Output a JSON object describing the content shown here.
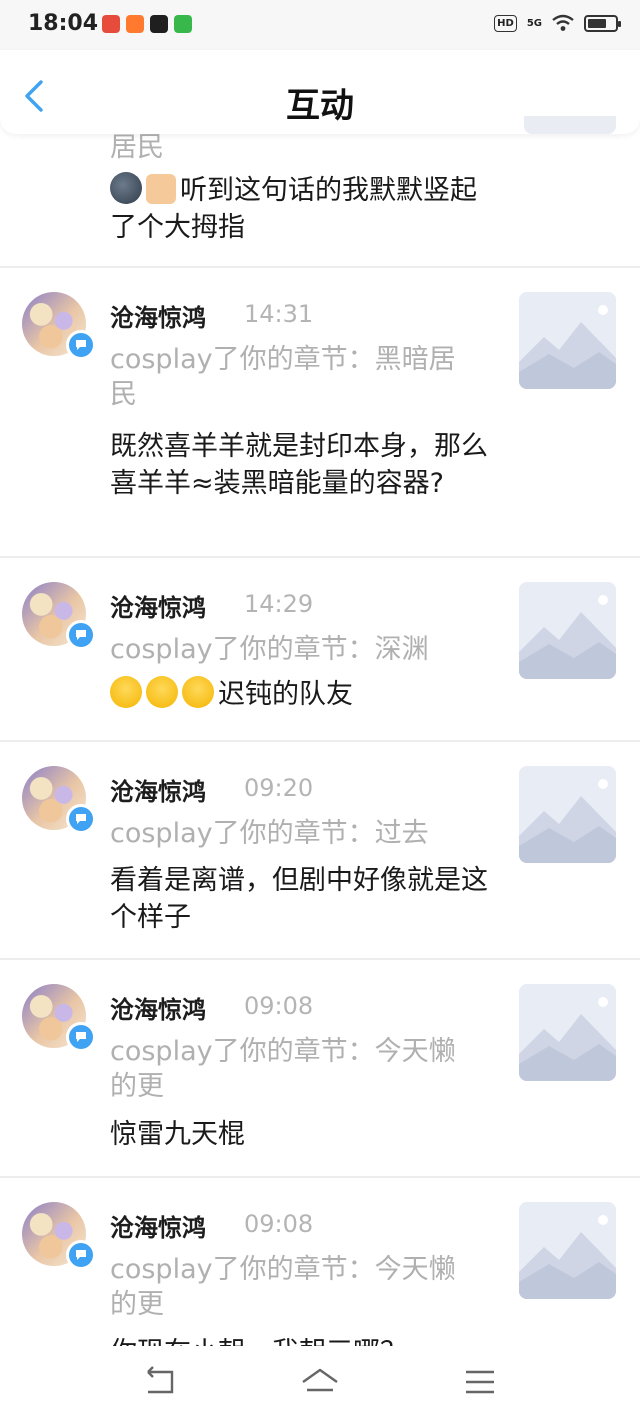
{
  "status_bar": {
    "time": "18:04",
    "hd": "HD",
    "signal": "5G"
  },
  "header": {
    "title": "互动"
  },
  "items": [
    {
      "ref": "居民",
      "body": "听到这句话的我默默竖起了个大拇指"
    },
    {
      "name": "沧海惊鸿",
      "time": "14:31",
      "ref": "cosplay了你的章节：黑暗居民",
      "body": "既然喜羊羊就是封印本身，那么喜羊羊≈装黑暗能量的容器?"
    },
    {
      "name": "沧海惊鸿",
      "time": "14:29",
      "ref": "cosplay了你的章节：深渊",
      "body": "迟钝的队友"
    },
    {
      "name": "沧海惊鸿",
      "time": "09:20",
      "ref": "cosplay了你的章节：过去",
      "body": "看着是离谱，但剧中好像就是这个样子"
    },
    {
      "name": "沧海惊鸿",
      "time": "09:08",
      "ref": "cosplay了你的章节：今天懒的更",
      "body": "惊雷九天棍"
    },
    {
      "name": "沧海惊鸿",
      "time": "09:08",
      "ref": "cosplay了你的章节：今天懒的更",
      "body": "你现在小朝，我朝三哪？"
    }
  ],
  "icons": {
    "back": "chevron-left-icon",
    "comment_badge": "speech-bubble-icon",
    "nav_back": "return-icon",
    "nav_home": "home-icon",
    "nav_menu": "menu-icon"
  },
  "colors": {
    "accent": "#3fa2f2",
    "muted": "#b0b0b0"
  }
}
